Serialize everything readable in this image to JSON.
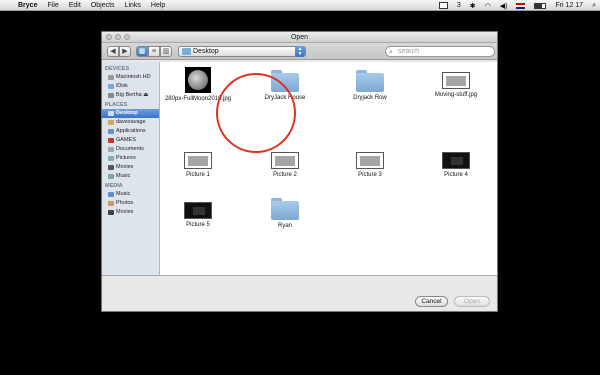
{
  "menubar": {
    "app_name": "Bryce",
    "items": [
      "File",
      "Edit",
      "Objects",
      "Links",
      "Help"
    ],
    "status_num": "3",
    "clock": "Fri 12 17"
  },
  "dialog": {
    "title": "Open",
    "nav": {
      "back": "◀",
      "forward": "▶"
    },
    "path_popup": "Desktop",
    "search_placeholder": "search"
  },
  "sidebar": {
    "devices_header": "DEVICES",
    "devices": [
      "Macintosh HD",
      "iDisk",
      "Big Bertha ⏏"
    ],
    "places_header": "PLACES",
    "places": [
      "Desktop",
      "davesavage",
      "Applications",
      "GAMES",
      "Documents",
      "Pictures",
      "Movies",
      "Music"
    ],
    "media_header": "MEDIA",
    "media": [
      "Music",
      "Photos",
      "Movies"
    ]
  },
  "files": [
    {
      "name": "280px-FullMoon2010.jpg",
      "kind": "moon"
    },
    {
      "name": "DryJack House",
      "kind": "folder"
    },
    {
      "name": "Dryjack Row",
      "kind": "folder"
    },
    {
      "name": "Moving-stuff.jpg",
      "kind": "shot"
    },
    {
      "name": "Picture 1",
      "kind": "shot"
    },
    {
      "name": "Picture 2",
      "kind": "shot"
    },
    {
      "name": "Picture 3",
      "kind": "shot"
    },
    {
      "name": "Picture 4",
      "kind": "dark"
    },
    {
      "name": "Picture 5",
      "kind": "dark"
    },
    {
      "name": "Ryan",
      "kind": "folder"
    }
  ],
  "buttons": {
    "cancel": "Cancel",
    "open": "Open"
  },
  "colors": {
    "selection": "#3e72c9",
    "annotation_circle": "#e03020"
  }
}
